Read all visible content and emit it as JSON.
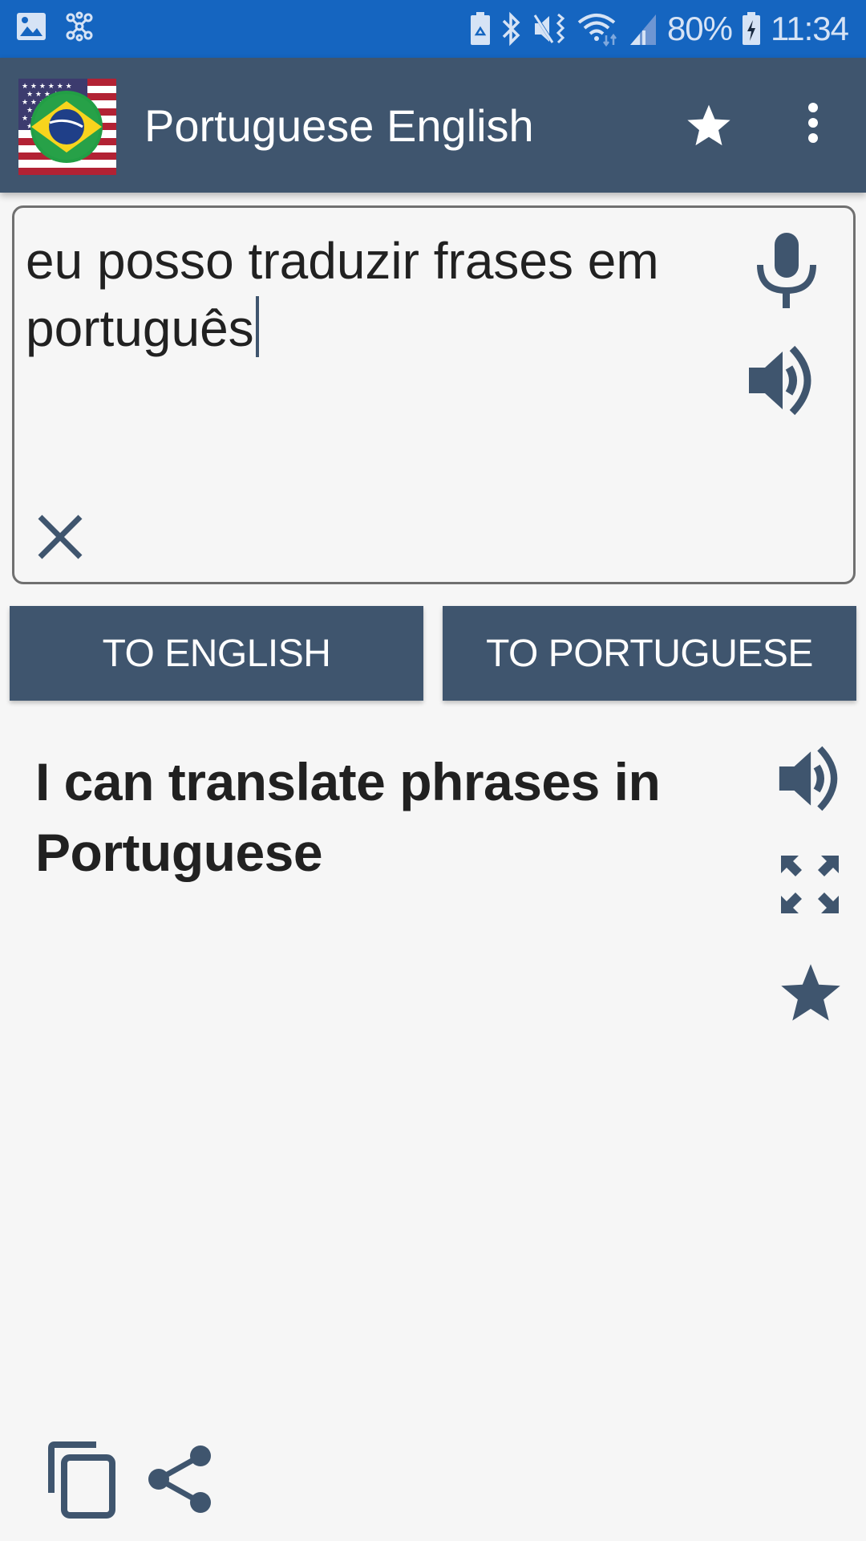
{
  "status_bar": {
    "left_icons": [
      "gallery-icon",
      "network-hub-icon"
    ],
    "right_icons": [
      "battery-saver-icon",
      "bluetooth-icon",
      "vibrate-mute-icon",
      "wifi-icon",
      "signal-icon"
    ],
    "battery_percent": "80%",
    "time": "11:34"
  },
  "app_bar": {
    "title": "Portuguese English",
    "logo": "us-brazil-flag-logo",
    "actions": [
      "favorites-star-icon",
      "overflow-menu-icon"
    ]
  },
  "input": {
    "text": "eu posso traduzir frases em português",
    "icons": [
      "microphone-icon",
      "speaker-icon",
      "clear-icon"
    ]
  },
  "buttons": {
    "to_english": "TO ENGLISH",
    "to_portuguese": "TO PORTUGUESE"
  },
  "output": {
    "text": "I can translate phrases in Portuguese",
    "icons": [
      "speaker-icon",
      "fullscreen-icon",
      "favorite-star-icon"
    ]
  },
  "bottom_actions": [
    "copy-icon",
    "share-icon"
  ],
  "colors": {
    "status_bar": "#1565c0",
    "primary": "#3f556e",
    "background": "#f6f6f6",
    "text": "#212121"
  }
}
